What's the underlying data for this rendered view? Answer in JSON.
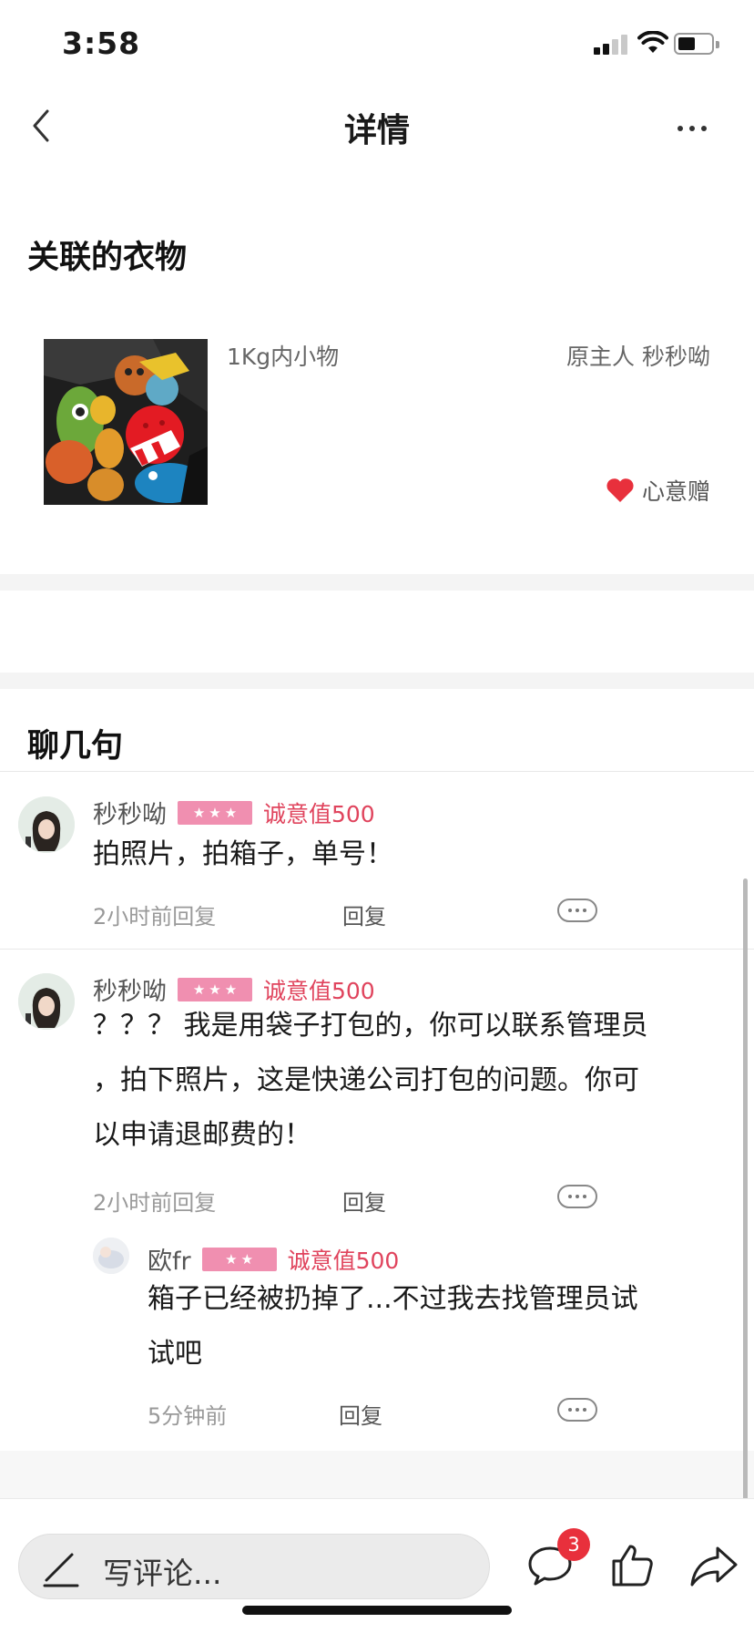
{
  "status_bar": {
    "time": "3:58"
  },
  "nav": {
    "title": "详情"
  },
  "related": {
    "section_title": "关联的衣物",
    "item": {
      "name": "1Kg内小物",
      "owner_label": "原主人 秒秒呦",
      "type_label": "心意赠"
    }
  },
  "chat": {
    "section_title": "聊几句",
    "comments": [
      {
        "username": "秒秒呦",
        "stars": "★★★",
        "sincerity": "诚意值500",
        "text_lines": [
          "拍照片，拍箱子，单号！"
        ],
        "time": "2小时前回复",
        "reply_label": "回复"
      },
      {
        "username": "秒秒呦",
        "stars": "★★★",
        "sincerity": "诚意值500",
        "text_lines": [
          "？？？ 我是用袋子打包的，你可以联系管理员",
          "，拍下照片，这是快递公司打包的问题。你可",
          "以申请退邮费的！"
        ],
        "time": "2小时前回复",
        "reply_label": "回复",
        "replies": [
          {
            "username": "欧fr",
            "stars": "★★",
            "sincerity": "诚意值500",
            "text_lines": [
              "箱子已经被扔掉了...不过我去找管理员试",
              "试吧"
            ],
            "time": "5分钟前",
            "reply_label": "回复"
          }
        ]
      }
    ]
  },
  "bottom_bar": {
    "input_placeholder": "写评论...",
    "comment_count": "3"
  },
  "colors": {
    "accent_red": "#e0445d",
    "star_badge": "#f08fb0",
    "heart": "#e8303c"
  }
}
